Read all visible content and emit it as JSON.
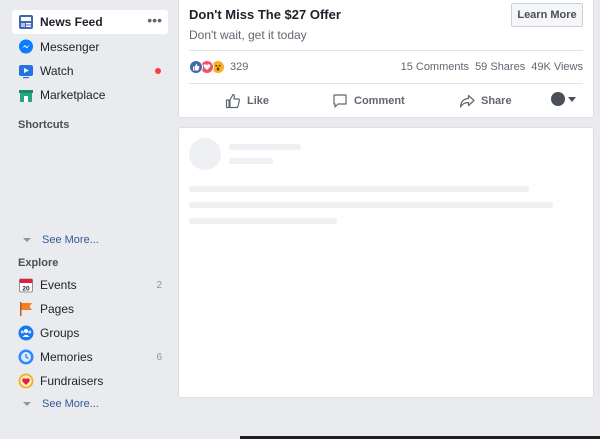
{
  "sidebar": {
    "main_items": [
      {
        "label": "News Feed",
        "icon": "news-feed-icon",
        "active": true,
        "menu": "•••"
      },
      {
        "label": "Messenger",
        "icon": "messenger-icon"
      },
      {
        "label": "Watch",
        "icon": "watch-icon",
        "notification": true
      },
      {
        "label": "Marketplace",
        "icon": "marketplace-icon"
      }
    ],
    "shortcuts_title": "Shortcuts",
    "shortcuts_see_more": "See More...",
    "explore_title": "Explore",
    "explore_items": [
      {
        "label": "Events",
        "icon": "events-calendar-icon",
        "count": "2",
        "calendar_day": "20"
      },
      {
        "label": "Pages",
        "icon": "pages-flag-icon",
        "count": ""
      },
      {
        "label": "Groups",
        "icon": "groups-icon",
        "count": ""
      },
      {
        "label": "Memories",
        "icon": "memories-clock-icon",
        "count": "6"
      },
      {
        "label": "Fundraisers",
        "icon": "fundraisers-heart-icon",
        "count": ""
      }
    ],
    "explore_see_more": "See More..."
  },
  "ad": {
    "title": "Don't Miss The $27 Offer",
    "subtitle": "Don't wait, get it today",
    "cta": "Learn More",
    "reactions": [
      "like-reaction",
      "love-reaction",
      "wow-reaction"
    ],
    "reaction_count": "329",
    "comments": "15 Comments",
    "shares": "59 Shares",
    "views": "49K Views",
    "actions": {
      "like": "Like",
      "comment": "Comment",
      "share": "Share"
    }
  },
  "colors": {
    "background": "#e9ebee",
    "link": "#365899",
    "notification": "#fa3e3e",
    "like_blue": "#4267b2",
    "love_red": "#f25268",
    "wow_yellow": "#f7b125"
  }
}
